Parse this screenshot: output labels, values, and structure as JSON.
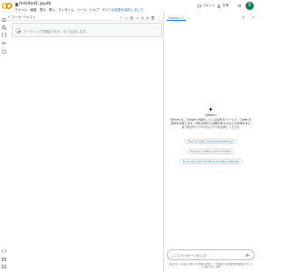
{
  "header": {
    "filename": "Untitled1.ipynb",
    "star_icon": "star-outline-icon",
    "menu": [
      "ファイル",
      "編集",
      "表示",
      "挿入",
      "ランタイム",
      "ツール",
      "ヘルプ"
    ],
    "saved_status": "すべての変更を保存しました",
    "comment_label": "コメント",
    "share_label": "共有",
    "avatar_initial": "S",
    "colors": {
      "accent": "#1a73e8",
      "logo_orange": "#f9ab00",
      "avatar": "#0b8043"
    }
  },
  "toolbar": {
    "code_label": "+ コード",
    "text_label": "+ テキスト",
    "connect_label": "接続",
    "gemini_label": "Gemini"
  },
  "notebook": {
    "cell_placeholder": "コーディングを開始するか、AI で生成します。"
  },
  "gemini": {
    "tab_label": "Gemini",
    "name": "Gemini",
    "description": "Gemini は、Google が提供している生成 AI ツールで、Colab の使用を支援します。何を達成する必要があるかなどの質問をまたは下記のサンプルプロンプトをお試しください",
    "suggestions": [
      "How do I filter a Pandas DataFrame?",
      "How do I create a plot in Colab?",
      "Show me a list of publicly available datasets"
    ],
    "input_placeholder": "ここにメッセージを入力",
    "disclaimer": "生成 AI は、Google が表示する情報とは異なり、不正確または不適切な情報を提示することがあります。詳細"
  },
  "rail_icons": [
    "menu-icon",
    "search-icon",
    "code-brackets-icon",
    "key-icon",
    "folder-icon"
  ],
  "rail_bottom_icons": [
    "code-icon",
    "terminal-icon"
  ]
}
